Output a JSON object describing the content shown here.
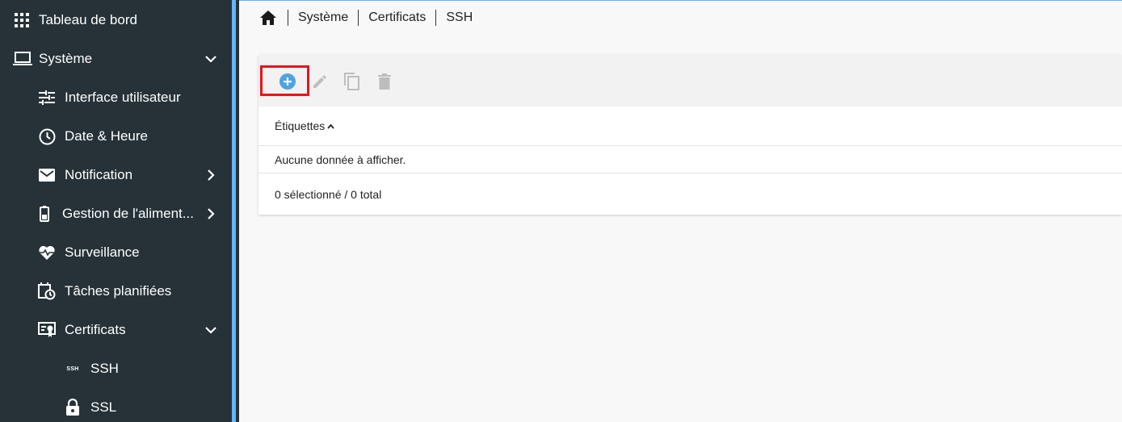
{
  "sidebar": {
    "items": [
      {
        "label": "Tableau de bord",
        "icon": "grid-icon"
      },
      {
        "label": "Système",
        "icon": "laptop-icon"
      },
      {
        "label": "Interface utilisateur",
        "icon": "sliders-icon"
      },
      {
        "label": "Date & Heure",
        "icon": "clock-icon"
      },
      {
        "label": "Notification",
        "icon": "mail-icon"
      },
      {
        "label": "Gestion de l'aliment...",
        "icon": "battery-icon"
      },
      {
        "label": "Surveillance",
        "icon": "heartbeat-icon"
      },
      {
        "label": "Tâches planifiées",
        "icon": "calendar-clock-icon"
      },
      {
        "label": "Certificats",
        "icon": "certificate-icon"
      },
      {
        "label": "SSH",
        "icon": "ssh-icon",
        "icon_text": "SSH"
      },
      {
        "label": "SSL",
        "icon": "lock-icon"
      }
    ]
  },
  "breadcrumb": {
    "items": [
      "Système",
      "Certificats",
      "SSH"
    ]
  },
  "table": {
    "columns": [
      {
        "label": "Étiquettes",
        "sort": "ascending"
      }
    ],
    "empty_message": "Aucune donnée à afficher.",
    "footer": "0 sélectionné / 0 total"
  },
  "toolbar": {
    "buttons": [
      "add-icon",
      "edit-icon",
      "copy-icon",
      "delete-icon"
    ]
  },
  "colors": {
    "sidebar_bg": "#263238",
    "accent": "#64b5f6",
    "add_button": "#4fa3e0",
    "highlight": "#e8141b",
    "disabled_icon": "#bdbdbd"
  }
}
